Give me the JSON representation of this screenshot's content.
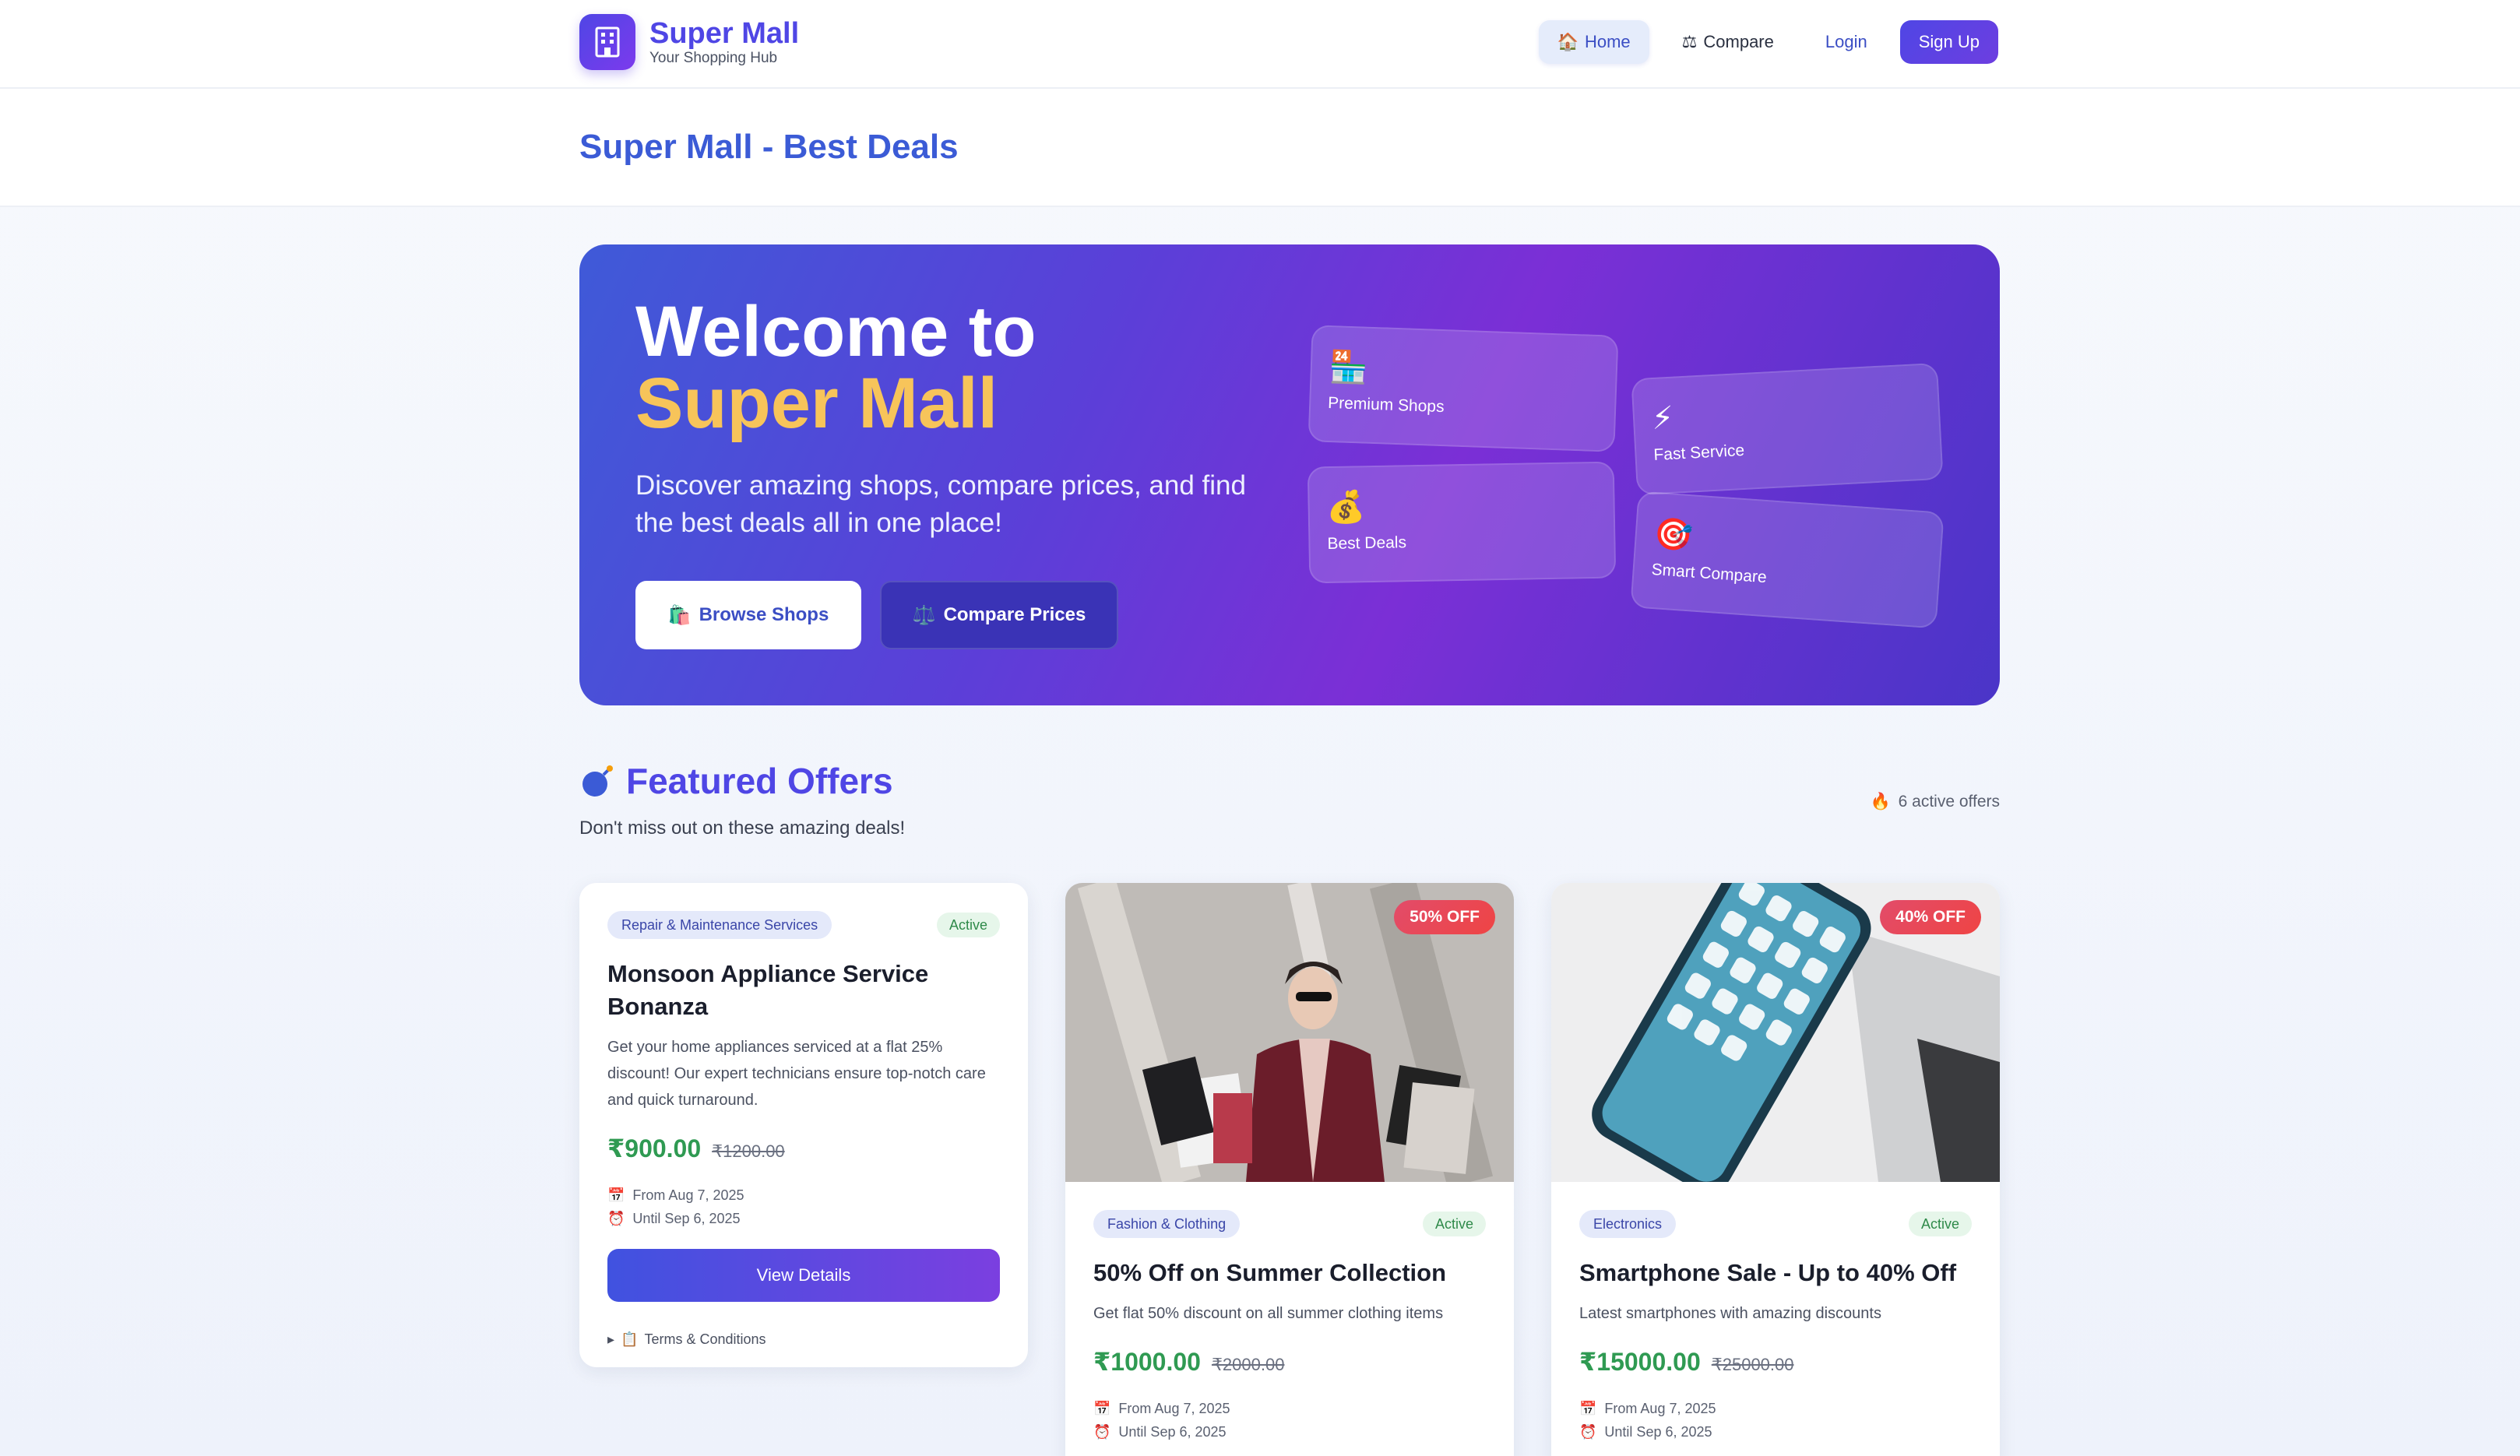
{
  "app": {
    "name": "Super Mall",
    "tagline": "Your Shopping Hub"
  },
  "nav": {
    "home": "Home",
    "compare": "Compare",
    "login": "Login",
    "signup": "Sign Up"
  },
  "page": {
    "title": "Super Mall - Best Deals"
  },
  "hero": {
    "title_line1": "Welcome to",
    "title_line2": "Super Mall",
    "description": "Discover amazing shops, compare prices, and find the best deals all in one place!",
    "browse_label": "Browse Shops",
    "compare_label": "Compare Prices",
    "features": [
      {
        "icon": "🏪",
        "label": "Premium Shops"
      },
      {
        "icon": "⚡",
        "label": "Fast Service"
      },
      {
        "icon": "💰",
        "label": "Best Deals"
      },
      {
        "icon": "🎯",
        "label": "Smart Compare"
      }
    ]
  },
  "featured": {
    "title": "Featured Offers",
    "subtitle": "Don't miss out on these amazing deals!",
    "active_count": "6 active offers"
  },
  "offers": [
    {
      "category": "Repair & Maintenance Services",
      "status": "Active",
      "title": "Monsoon Appliance Service Bonanza",
      "description": "Get your home appliances serviced at a flat 25% discount! Our expert technicians ensure top-notch care and quick turnaround.",
      "price": "₹900.00",
      "old_price": "₹1200.00",
      "from": "From Aug 7, 2025",
      "until": "Until Sep 6, 2025",
      "button": "View Details",
      "terms": "Terms & Conditions"
    },
    {
      "discount": "50% OFF",
      "category": "Fashion & Clothing",
      "status": "Active",
      "title": "50% Off on Summer Collection",
      "description": "Get flat 50% discount on all summer clothing items",
      "price": "₹1000.00",
      "old_price": "₹2000.00",
      "from": "From Aug 7, 2025",
      "until": "Until Sep 6, 2025"
    },
    {
      "discount": "40% OFF",
      "category": "Electronics",
      "status": "Active",
      "title": "Smartphone Sale - Up to 40% Off",
      "description": "Latest smartphones with amazing discounts",
      "price": "₹15000.00",
      "old_price": "₹25000.00",
      "from": "From Aug 7, 2025",
      "until": "Until Sep 6, 2025"
    }
  ]
}
